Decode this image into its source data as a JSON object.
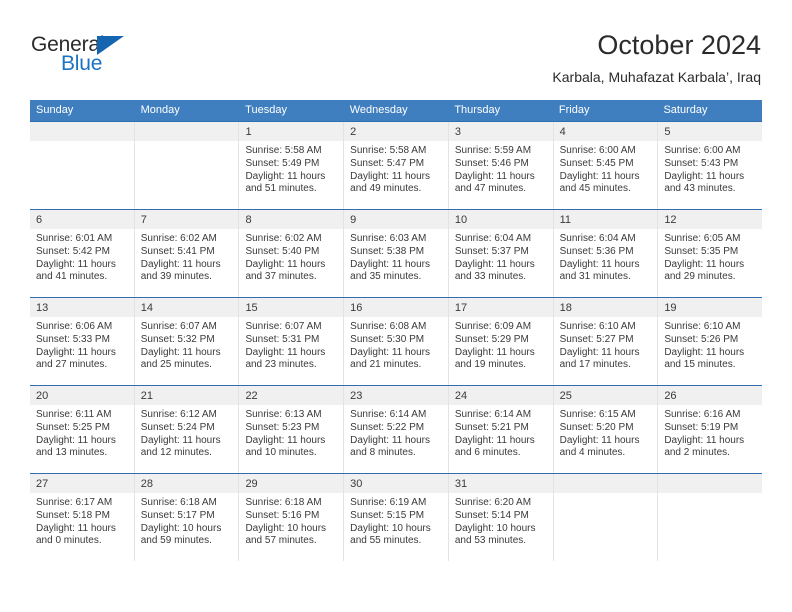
{
  "brand": {
    "name_part1": "General",
    "name_part2": "Blue",
    "accent_color": "#1565b0"
  },
  "header": {
    "title": "October 2024",
    "subtitle": "Karbala, Muhafazat Karbala’, Iraq"
  },
  "calendar": {
    "header_bg": "#3f7fbf",
    "weekdays": [
      "Sunday",
      "Monday",
      "Tuesday",
      "Wednesday",
      "Thursday",
      "Friday",
      "Saturday"
    ],
    "weeks": [
      [
        {
          "day": ""
        },
        {
          "day": ""
        },
        {
          "day": "1",
          "sunrise": "Sunrise: 5:58 AM",
          "sunset": "Sunset: 5:49 PM",
          "daylight1": "Daylight: 11 hours",
          "daylight2": "and 51 minutes."
        },
        {
          "day": "2",
          "sunrise": "Sunrise: 5:58 AM",
          "sunset": "Sunset: 5:47 PM",
          "daylight1": "Daylight: 11 hours",
          "daylight2": "and 49 minutes."
        },
        {
          "day": "3",
          "sunrise": "Sunrise: 5:59 AM",
          "sunset": "Sunset: 5:46 PM",
          "daylight1": "Daylight: 11 hours",
          "daylight2": "and 47 minutes."
        },
        {
          "day": "4",
          "sunrise": "Sunrise: 6:00 AM",
          "sunset": "Sunset: 5:45 PM",
          "daylight1": "Daylight: 11 hours",
          "daylight2": "and 45 minutes."
        },
        {
          "day": "5",
          "sunrise": "Sunrise: 6:00 AM",
          "sunset": "Sunset: 5:43 PM",
          "daylight1": "Daylight: 11 hours",
          "daylight2": "and 43 minutes."
        }
      ],
      [
        {
          "day": "6",
          "sunrise": "Sunrise: 6:01 AM",
          "sunset": "Sunset: 5:42 PM",
          "daylight1": "Daylight: 11 hours",
          "daylight2": "and 41 minutes."
        },
        {
          "day": "7",
          "sunrise": "Sunrise: 6:02 AM",
          "sunset": "Sunset: 5:41 PM",
          "daylight1": "Daylight: 11 hours",
          "daylight2": "and 39 minutes."
        },
        {
          "day": "8",
          "sunrise": "Sunrise: 6:02 AM",
          "sunset": "Sunset: 5:40 PM",
          "daylight1": "Daylight: 11 hours",
          "daylight2": "and 37 minutes."
        },
        {
          "day": "9",
          "sunrise": "Sunrise: 6:03 AM",
          "sunset": "Sunset: 5:38 PM",
          "daylight1": "Daylight: 11 hours",
          "daylight2": "and 35 minutes."
        },
        {
          "day": "10",
          "sunrise": "Sunrise: 6:04 AM",
          "sunset": "Sunset: 5:37 PM",
          "daylight1": "Daylight: 11 hours",
          "daylight2": "and 33 minutes."
        },
        {
          "day": "11",
          "sunrise": "Sunrise: 6:04 AM",
          "sunset": "Sunset: 5:36 PM",
          "daylight1": "Daylight: 11 hours",
          "daylight2": "and 31 minutes."
        },
        {
          "day": "12",
          "sunrise": "Sunrise: 6:05 AM",
          "sunset": "Sunset: 5:35 PM",
          "daylight1": "Daylight: 11 hours",
          "daylight2": "and 29 minutes."
        }
      ],
      [
        {
          "day": "13",
          "sunrise": "Sunrise: 6:06 AM",
          "sunset": "Sunset: 5:33 PM",
          "daylight1": "Daylight: 11 hours",
          "daylight2": "and 27 minutes."
        },
        {
          "day": "14",
          "sunrise": "Sunrise: 6:07 AM",
          "sunset": "Sunset: 5:32 PM",
          "daylight1": "Daylight: 11 hours",
          "daylight2": "and 25 minutes."
        },
        {
          "day": "15",
          "sunrise": "Sunrise: 6:07 AM",
          "sunset": "Sunset: 5:31 PM",
          "daylight1": "Daylight: 11 hours",
          "daylight2": "and 23 minutes."
        },
        {
          "day": "16",
          "sunrise": "Sunrise: 6:08 AM",
          "sunset": "Sunset: 5:30 PM",
          "daylight1": "Daylight: 11 hours",
          "daylight2": "and 21 minutes."
        },
        {
          "day": "17",
          "sunrise": "Sunrise: 6:09 AM",
          "sunset": "Sunset: 5:29 PM",
          "daylight1": "Daylight: 11 hours",
          "daylight2": "and 19 minutes."
        },
        {
          "day": "18",
          "sunrise": "Sunrise: 6:10 AM",
          "sunset": "Sunset: 5:27 PM",
          "daylight1": "Daylight: 11 hours",
          "daylight2": "and 17 minutes."
        },
        {
          "day": "19",
          "sunrise": "Sunrise: 6:10 AM",
          "sunset": "Sunset: 5:26 PM",
          "daylight1": "Daylight: 11 hours",
          "daylight2": "and 15 minutes."
        }
      ],
      [
        {
          "day": "20",
          "sunrise": "Sunrise: 6:11 AM",
          "sunset": "Sunset: 5:25 PM",
          "daylight1": "Daylight: 11 hours",
          "daylight2": "and 13 minutes."
        },
        {
          "day": "21",
          "sunrise": "Sunrise: 6:12 AM",
          "sunset": "Sunset: 5:24 PM",
          "daylight1": "Daylight: 11 hours",
          "daylight2": "and 12 minutes."
        },
        {
          "day": "22",
          "sunrise": "Sunrise: 6:13 AM",
          "sunset": "Sunset: 5:23 PM",
          "daylight1": "Daylight: 11 hours",
          "daylight2": "and 10 minutes."
        },
        {
          "day": "23",
          "sunrise": "Sunrise: 6:14 AM",
          "sunset": "Sunset: 5:22 PM",
          "daylight1": "Daylight: 11 hours",
          "daylight2": "and 8 minutes."
        },
        {
          "day": "24",
          "sunrise": "Sunrise: 6:14 AM",
          "sunset": "Sunset: 5:21 PM",
          "daylight1": "Daylight: 11 hours",
          "daylight2": "and 6 minutes."
        },
        {
          "day": "25",
          "sunrise": "Sunrise: 6:15 AM",
          "sunset": "Sunset: 5:20 PM",
          "daylight1": "Daylight: 11 hours",
          "daylight2": "and 4 minutes."
        },
        {
          "day": "26",
          "sunrise": "Sunrise: 6:16 AM",
          "sunset": "Sunset: 5:19 PM",
          "daylight1": "Daylight: 11 hours",
          "daylight2": "and 2 minutes."
        }
      ],
      [
        {
          "day": "27",
          "sunrise": "Sunrise: 6:17 AM",
          "sunset": "Sunset: 5:18 PM",
          "daylight1": "Daylight: 11 hours",
          "daylight2": "and 0 minutes."
        },
        {
          "day": "28",
          "sunrise": "Sunrise: 6:18 AM",
          "sunset": "Sunset: 5:17 PM",
          "daylight1": "Daylight: 10 hours",
          "daylight2": "and 59 minutes."
        },
        {
          "day": "29",
          "sunrise": "Sunrise: 6:18 AM",
          "sunset": "Sunset: 5:16 PM",
          "daylight1": "Daylight: 10 hours",
          "daylight2": "and 57 minutes."
        },
        {
          "day": "30",
          "sunrise": "Sunrise: 6:19 AM",
          "sunset": "Sunset: 5:15 PM",
          "daylight1": "Daylight: 10 hours",
          "daylight2": "and 55 minutes."
        },
        {
          "day": "31",
          "sunrise": "Sunrise: 6:20 AM",
          "sunset": "Sunset: 5:14 PM",
          "daylight1": "Daylight: 10 hours",
          "daylight2": "and 53 minutes."
        },
        {
          "day": ""
        },
        {
          "day": ""
        }
      ]
    ]
  }
}
